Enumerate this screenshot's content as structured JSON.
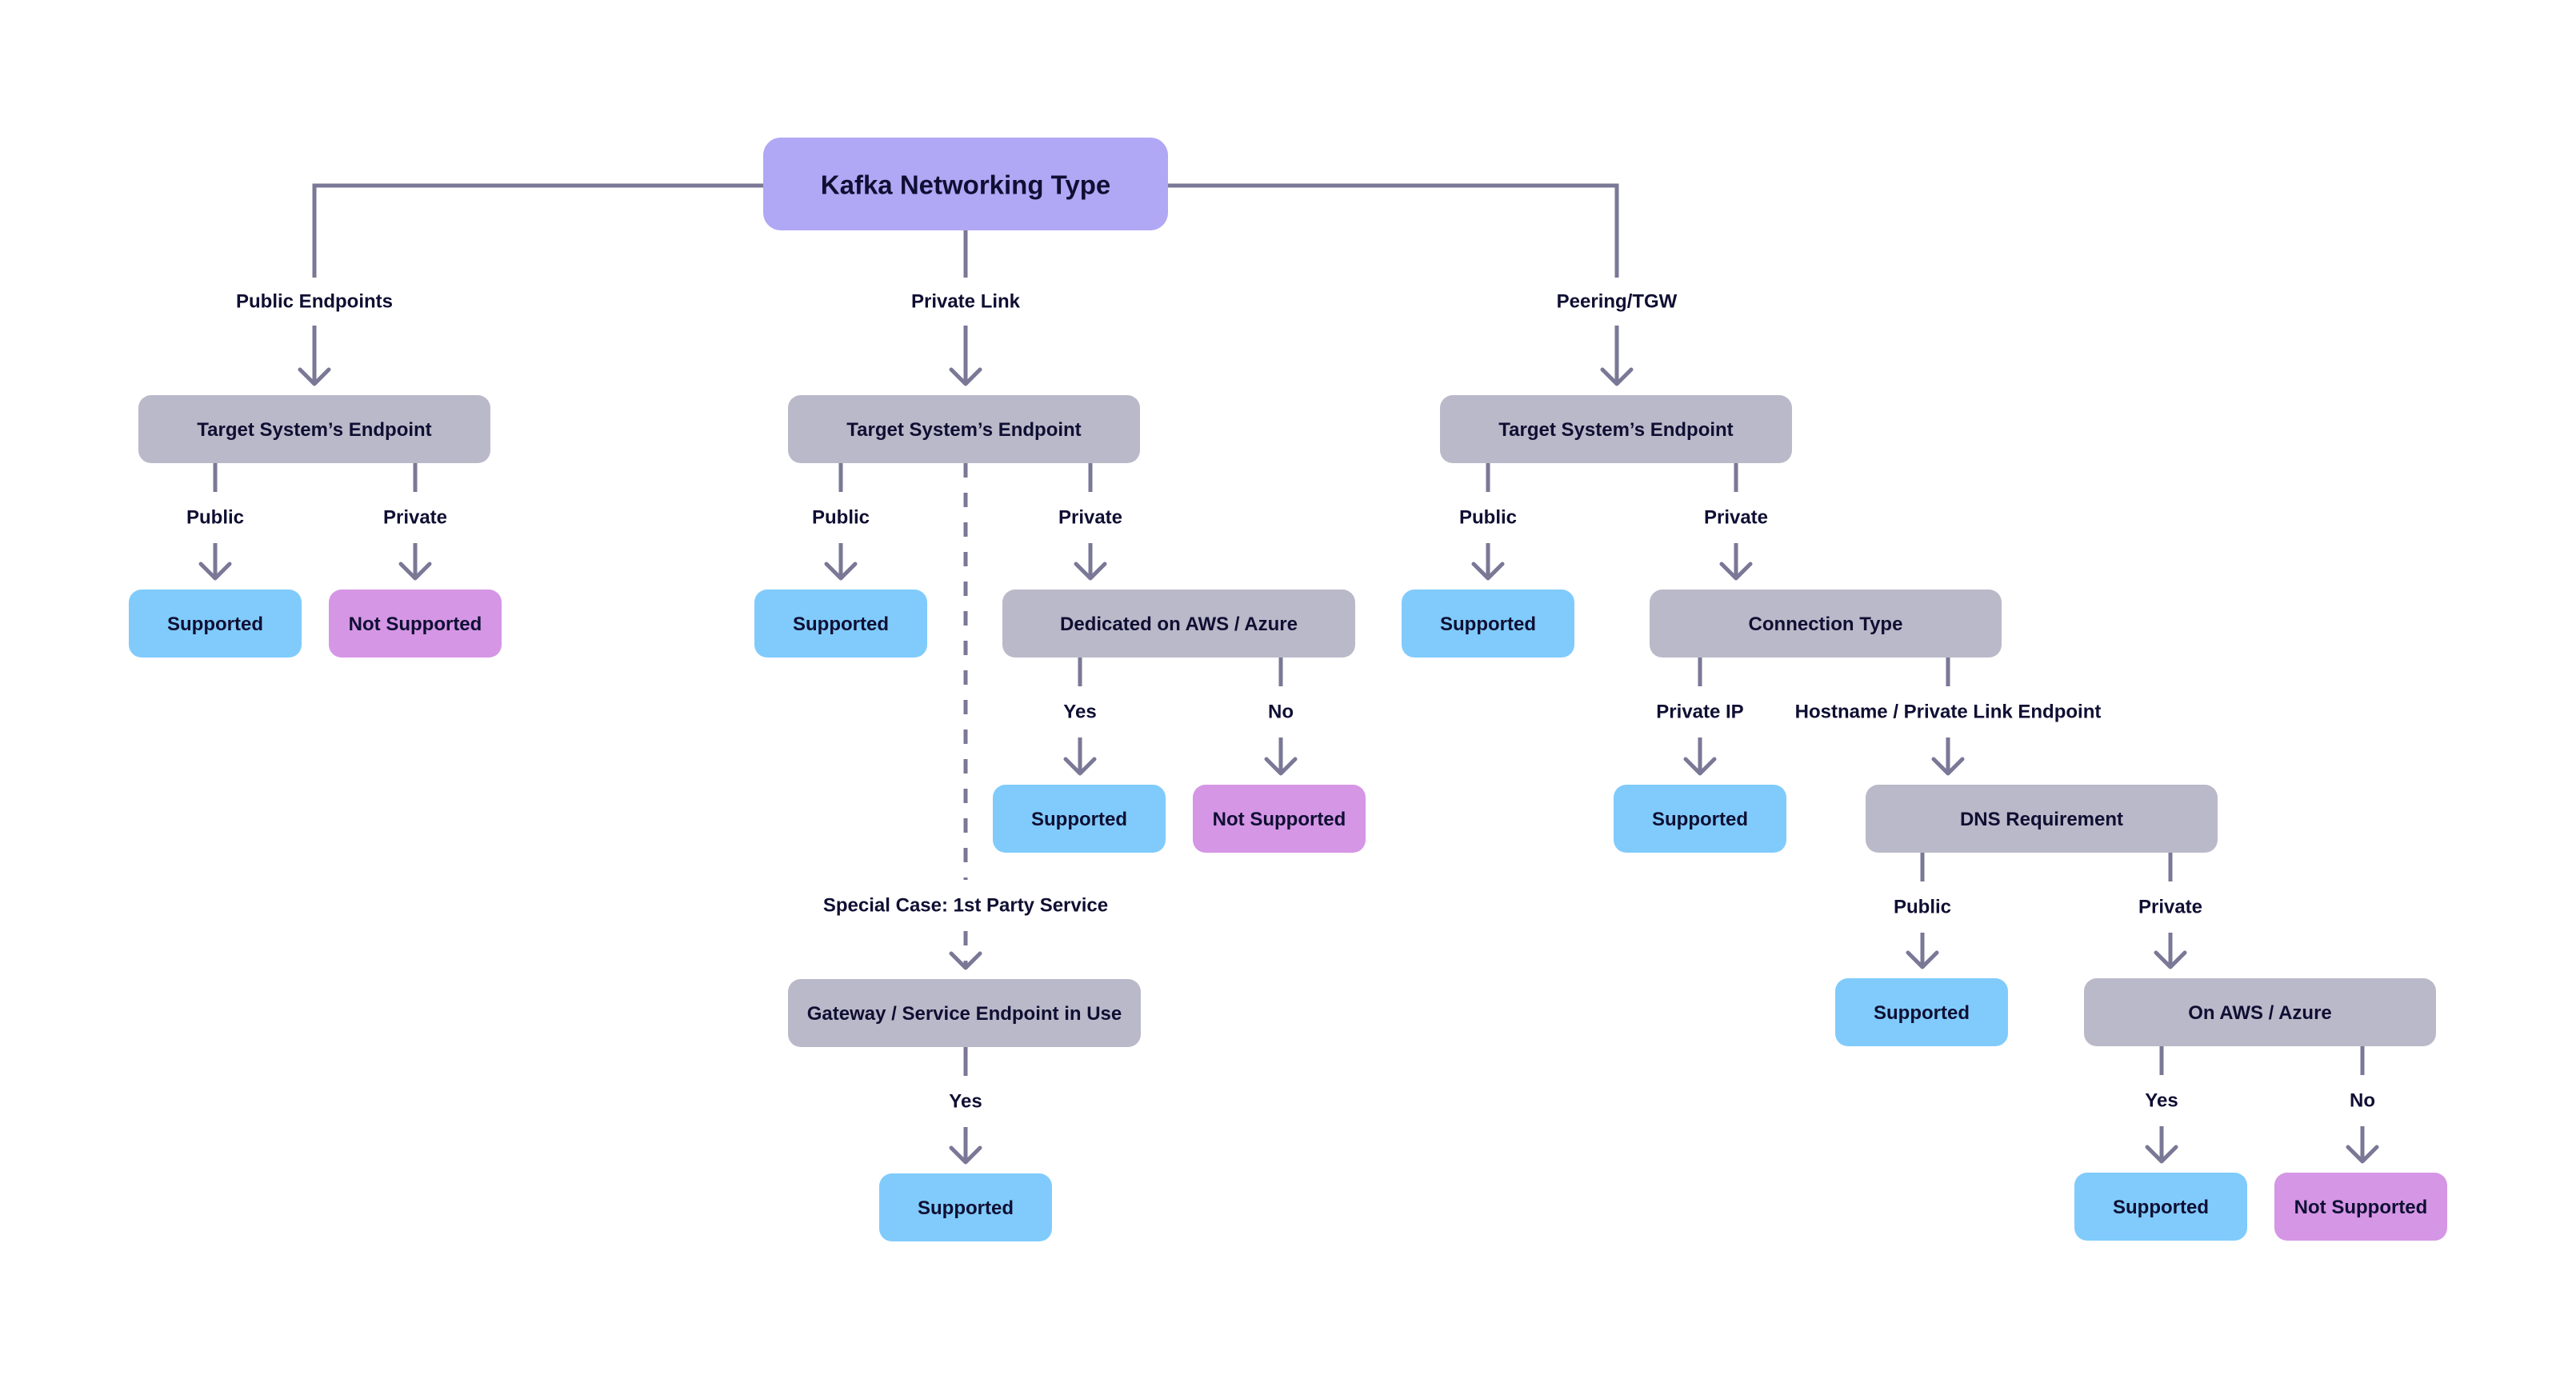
{
  "diagram": {
    "title": "Kafka Networking Type",
    "colors": {
      "root": "#b0a8f5",
      "decision": "#bab9c9",
      "supported": "#80cbfc",
      "not_supported": "#d596e5",
      "connector": "#7a7896",
      "text": "#0f0f33"
    },
    "nodes": [
      {
        "id": "root",
        "type": "root",
        "label": "Kafka Networking Type"
      },
      {
        "id": "pub-target",
        "type": "decision",
        "label": "Target System’s Endpoint"
      },
      {
        "id": "pub-public-result",
        "type": "supported",
        "label": "Supported"
      },
      {
        "id": "pub-private-result",
        "type": "not_supported",
        "label": "Not Supported"
      },
      {
        "id": "pl-target",
        "type": "decision",
        "label": "Target System’s Endpoint"
      },
      {
        "id": "pl-public-result",
        "type": "supported",
        "label": "Supported"
      },
      {
        "id": "pl-dedicated",
        "type": "decision",
        "label": "Dedicated on AWS / Azure"
      },
      {
        "id": "pl-dedicated-yes",
        "type": "supported",
        "label": "Supported"
      },
      {
        "id": "pl-dedicated-no",
        "type": "not_supported",
        "label": "Not Supported"
      },
      {
        "id": "pl-gateway",
        "type": "decision",
        "label": "Gateway / Service Endpoint in Use"
      },
      {
        "id": "pl-gateway-yes",
        "type": "supported",
        "label": "Supported"
      },
      {
        "id": "peer-target",
        "type": "decision",
        "label": "Target System’s Endpoint"
      },
      {
        "id": "peer-public-result",
        "type": "supported",
        "label": "Supported"
      },
      {
        "id": "peer-conn-type",
        "type": "decision",
        "label": "Connection Type"
      },
      {
        "id": "peer-privateip-result",
        "type": "supported",
        "label": "Supported"
      },
      {
        "id": "peer-dns",
        "type": "decision",
        "label": "DNS Requirement"
      },
      {
        "id": "peer-dns-public-result",
        "type": "supported",
        "label": "Supported"
      },
      {
        "id": "peer-onaws",
        "type": "decision",
        "label": "On AWS / Azure"
      },
      {
        "id": "peer-onaws-yes",
        "type": "supported",
        "label": "Supported"
      },
      {
        "id": "peer-onaws-no",
        "type": "not_supported",
        "label": "Not Supported"
      }
    ],
    "edges": [
      {
        "from": "root",
        "to": "pub-target",
        "label": "Public Endpoints",
        "style": "solid"
      },
      {
        "from": "root",
        "to": "pl-target",
        "label": "Private Link",
        "style": "solid"
      },
      {
        "from": "root",
        "to": "peer-target",
        "label": "Peering/TGW",
        "style": "solid"
      },
      {
        "from": "pub-target",
        "to": "pub-public-result",
        "label": "Public",
        "style": "solid"
      },
      {
        "from": "pub-target",
        "to": "pub-private-result",
        "label": "Private",
        "style": "solid"
      },
      {
        "from": "pl-target",
        "to": "pl-public-result",
        "label": "Public",
        "style": "solid"
      },
      {
        "from": "pl-target",
        "to": "pl-dedicated",
        "label": "Private",
        "style": "solid"
      },
      {
        "from": "pl-target",
        "to": "pl-gateway",
        "label": "Special Case: 1st Party Service",
        "style": "dashed"
      },
      {
        "from": "pl-dedicated",
        "to": "pl-dedicated-yes",
        "label": "Yes",
        "style": "solid"
      },
      {
        "from": "pl-dedicated",
        "to": "pl-dedicated-no",
        "label": "No",
        "style": "solid"
      },
      {
        "from": "pl-gateway",
        "to": "pl-gateway-yes",
        "label": "Yes",
        "style": "solid"
      },
      {
        "from": "peer-target",
        "to": "peer-public-result",
        "label": "Public",
        "style": "solid"
      },
      {
        "from": "peer-target",
        "to": "peer-conn-type",
        "label": "Private",
        "style": "solid"
      },
      {
        "from": "peer-conn-type",
        "to": "peer-privateip-result",
        "label": "Private IP",
        "style": "solid"
      },
      {
        "from": "peer-conn-type",
        "to": "peer-dns",
        "label": "Hostname / Private Link Endpoint",
        "style": "solid"
      },
      {
        "from": "peer-dns",
        "to": "peer-dns-public-result",
        "label": "Public",
        "style": "solid"
      },
      {
        "from": "peer-dns",
        "to": "peer-onaws",
        "label": "Private",
        "style": "solid"
      },
      {
        "from": "peer-onaws",
        "to": "peer-onaws-yes",
        "label": "Yes",
        "style": "solid"
      },
      {
        "from": "peer-onaws",
        "to": "peer-onaws-no",
        "label": "No",
        "style": "solid"
      }
    ]
  }
}
